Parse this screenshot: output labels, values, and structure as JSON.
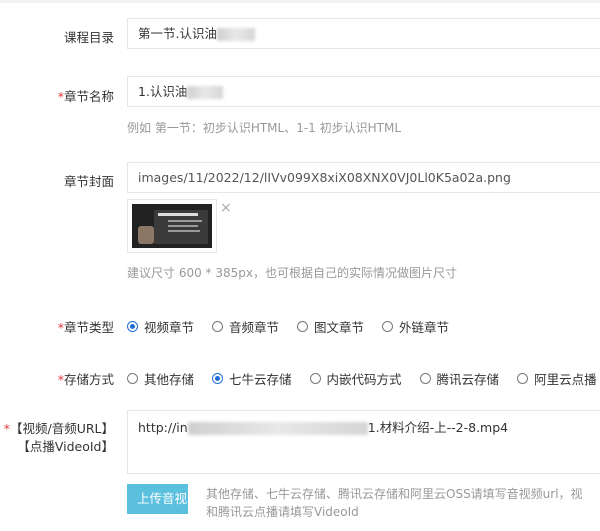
{
  "course_dir": {
    "label": "课程目录",
    "value": "第一节.认识油"
  },
  "chapter_name": {
    "label": "章节名称",
    "required": "*",
    "value": "1.认识油",
    "hint": "例如 第一节：初步认识HTML、1-1 初步认识HTML"
  },
  "chapter_cover": {
    "label": "章节封面",
    "value": "images/11/2022/12/lIVv099X8xiX08XNX0VJ0Ll0K5a02a.png",
    "hint": "建议尺寸 600 * 385px，也可根据自己的实际情况做图片尺寸",
    "remove_icon": "×"
  },
  "chapter_type": {
    "label": "章节类型",
    "required": "*",
    "options": [
      "视频章节",
      "音频章节",
      "图文章节",
      "外链章节"
    ],
    "selected": 0
  },
  "storage": {
    "label": "存储方式",
    "required": "*",
    "options": [
      "其他存储",
      "七牛云存储",
      "内嵌代码方式",
      "腾讯云存储",
      "阿里云点播"
    ],
    "selected": 1
  },
  "media_url": {
    "label_line1": "【视频/音频URL】",
    "label_line2": "【点播VideoId】",
    "required": "*",
    "value_prefix": "http://in",
    "value_suffix": "1.材料介绍-上--2-8.mp4"
  },
  "upload": {
    "button": "上传音视",
    "hint_line1": "其他存储、七牛云存储、腾讯云存储和阿里云OSS请填写音视频url，视",
    "hint_line2": "和腾讯云点播请填写VideoId"
  },
  "colors": {
    "accent": "#1e6fd9",
    "required": "#e4393c",
    "upload_button": "#5bc0de"
  }
}
